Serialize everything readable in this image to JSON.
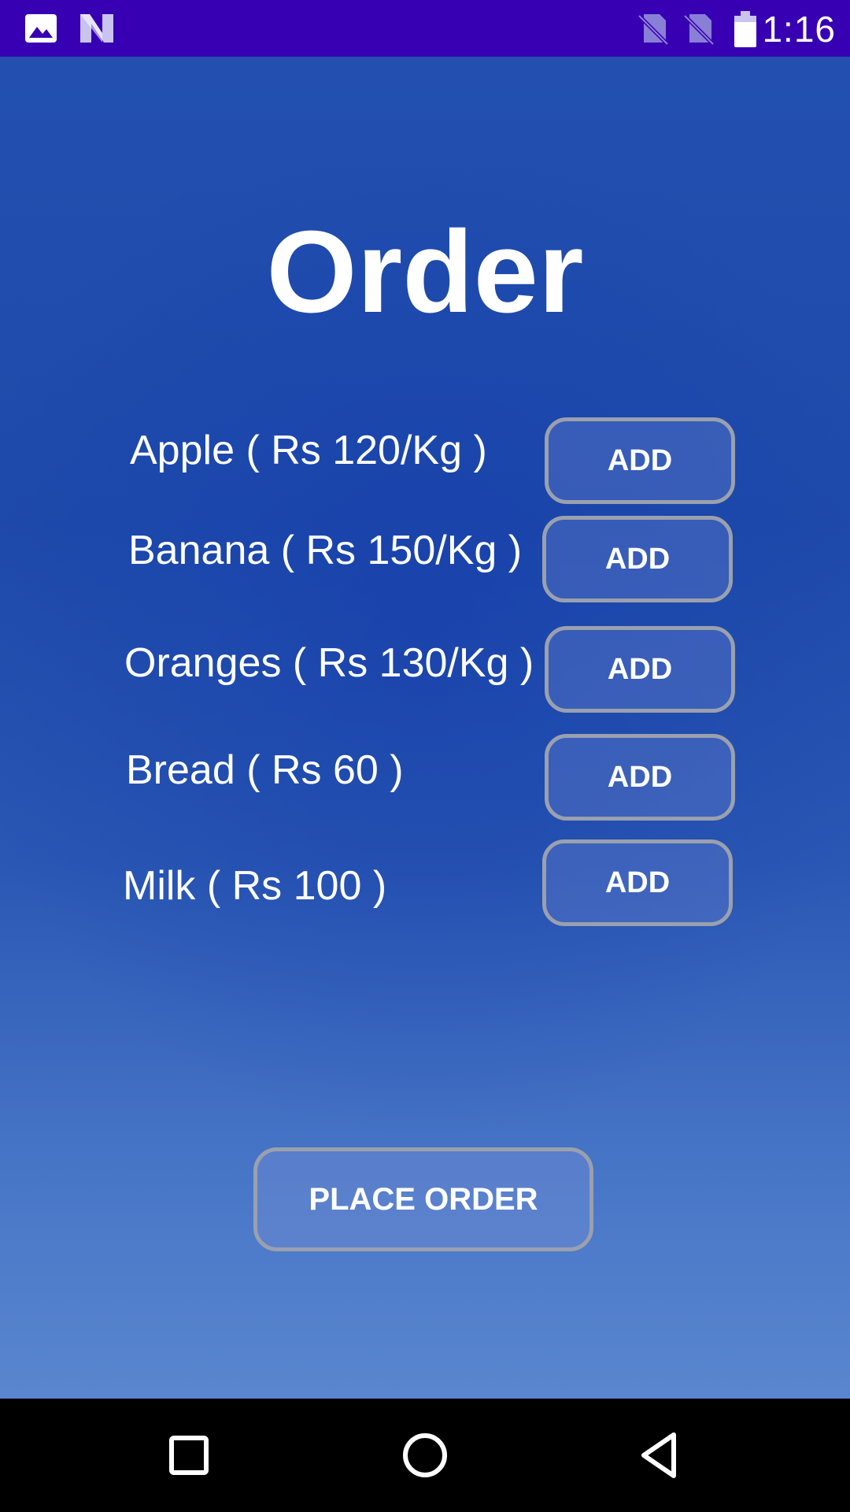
{
  "status_bar": {
    "time": "1:16",
    "icons": [
      "image-icon",
      "n-logo-icon",
      "no-sim-icon",
      "no-sim-icon",
      "battery-icon"
    ]
  },
  "page": {
    "title": "Order"
  },
  "items": [
    {
      "label": "Apple ( Rs 120/Kg )",
      "button": "ADD"
    },
    {
      "label": "Banana ( Rs 150/Kg )",
      "button": "ADD"
    },
    {
      "label": "Oranges ( Rs 130/Kg )",
      "button": "ADD"
    },
    {
      "label": "Bread ( Rs 60 )",
      "button": "ADD"
    },
    {
      "label": "Milk ( Rs 100 )",
      "button": "ADD"
    }
  ],
  "actions": {
    "place_order_label": "PLACE ORDER"
  },
  "navigation": {
    "buttons": [
      "recents-icon",
      "home-icon",
      "back-icon"
    ]
  },
  "colors": {
    "status_bar": "#3700b3",
    "background": "#1e4aab",
    "text": "#ffffff",
    "button_border": "#9aa0ae"
  }
}
